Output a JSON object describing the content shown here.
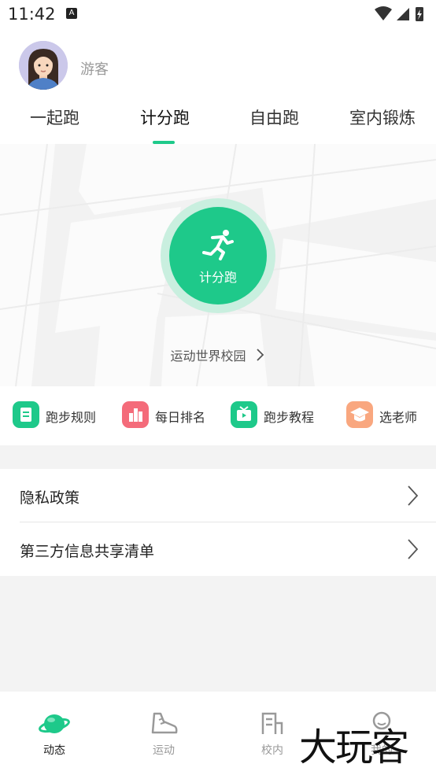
{
  "status_bar": {
    "time": "11:42",
    "notification_icon": "A"
  },
  "header": {
    "username": "游客"
  },
  "tabs": [
    {
      "label": "一起跑"
    },
    {
      "label": "计分跑"
    },
    {
      "label": "自由跑"
    },
    {
      "label": "室内锻炼"
    }
  ],
  "start_button": {
    "label": "计分跑"
  },
  "school_link": {
    "label": "运动世界校园"
  },
  "quick_actions": [
    {
      "label": "跑步规则",
      "color": "#1ec98a"
    },
    {
      "label": "每日排名",
      "color": "#f46b7a"
    },
    {
      "label": "跑步教程",
      "color": "#1ec98a"
    },
    {
      "label": "选老师",
      "color": "#f9a77f"
    }
  ],
  "list_items": [
    {
      "label": "隐私政策"
    },
    {
      "label": "第三方信息共享清单"
    }
  ],
  "bottom_nav": [
    {
      "label": "动态",
      "icon": "planet-icon"
    },
    {
      "label": "运动",
      "icon": "shoe-icon"
    },
    {
      "label": "校内",
      "icon": "school-icon"
    },
    {
      "label": "我的",
      "icon": "profile-icon"
    }
  ],
  "watermark": {
    "text": "大玩客"
  },
  "colors": {
    "accent": "#1ec98a"
  }
}
